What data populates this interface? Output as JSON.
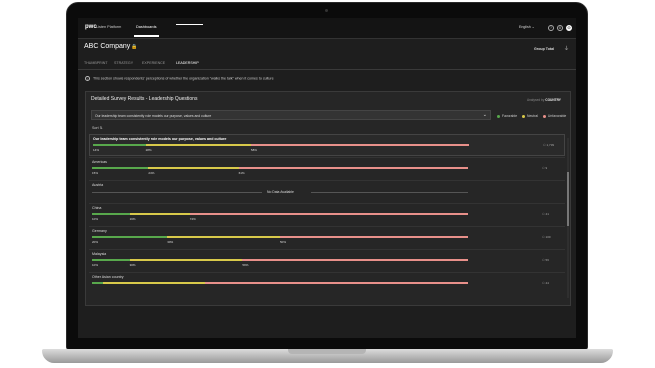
{
  "topbar": {
    "logo": "pwc",
    "platform": "Listen Platform",
    "nav_item": "Dashboards",
    "language": "English",
    "language_chevron": "⌄",
    "icons": [
      "help-icon",
      "settings-icon",
      "user-icon"
    ],
    "help_glyph": "?",
    "settings_glyph": "⚙",
    "user_glyph": "⏻"
  },
  "header": {
    "company": "ABC Company",
    "lock_glyph": "🔒",
    "group": "Group Total",
    "filter_glyph": "⏚"
  },
  "tabs": [
    {
      "label": "THUMBPRINT",
      "active": false
    },
    {
      "label": "STRATEGY",
      "active": false
    },
    {
      "label": "EXPERIENCE",
      "active": false
    },
    {
      "label": "LEADERSHIP",
      "active": true
    }
  ],
  "info": {
    "glyph": "i",
    "text": "This section shows respondents' perceptions of whether the organization \"walks the talk\" when it comes to culture"
  },
  "panel": {
    "title": "Detailed Survey Results - Leadership Questions",
    "analysed_prefix": "Analysed by",
    "analysed_value": "COUNTRY",
    "question_select": "Our leadership team consistently role models our purpose, values and culture",
    "select_chevron": "⌄",
    "legend": [
      {
        "label": "Favorable",
        "color": "#58a84c"
      },
      {
        "label": "Neutral",
        "color": "#d8c94a"
      },
      {
        "label": "Unfavorable",
        "color": "#e8908a"
      }
    ],
    "sort_label": "Sort",
    "sort_glyph": "⇅",
    "no_data_text": "No Data Available",
    "count_glyph": "⚇"
  },
  "rows": [
    {
      "label": "Our leadership team consistently role models our purpose, values and culture",
      "type": "question",
      "fav": 14,
      "neu": 28,
      "labels": [
        "14%",
        "28%",
        "58%"
      ],
      "count": "1,739"
    },
    {
      "label": "Americas",
      "type": "row",
      "fav": 15,
      "neu": 24,
      "labels": [
        "15%",
        "24%",
        "61%"
      ],
      "count": "9"
    },
    {
      "label": "Austria",
      "type": "nodata"
    },
    {
      "label": "China",
      "type": "row",
      "fav": 10,
      "neu": 16,
      "labels": [
        "10%",
        "16%",
        "74%"
      ],
      "count": "41"
    },
    {
      "label": "Germany",
      "type": "row",
      "fav": 20,
      "neu": 30,
      "labels": [
        "20%",
        "30%",
        "50%"
      ],
      "count": "100"
    },
    {
      "label": "Malaysia",
      "type": "row",
      "fav": 10,
      "neu": 30,
      "labels": [
        "10%",
        "30%",
        "59%"
      ],
      "count": "56"
    },
    {
      "label": "Other Asian country",
      "type": "row",
      "fav": 3,
      "neu": 27,
      "labels": [
        "",
        "",
        ""
      ],
      "count": "44"
    }
  ]
}
